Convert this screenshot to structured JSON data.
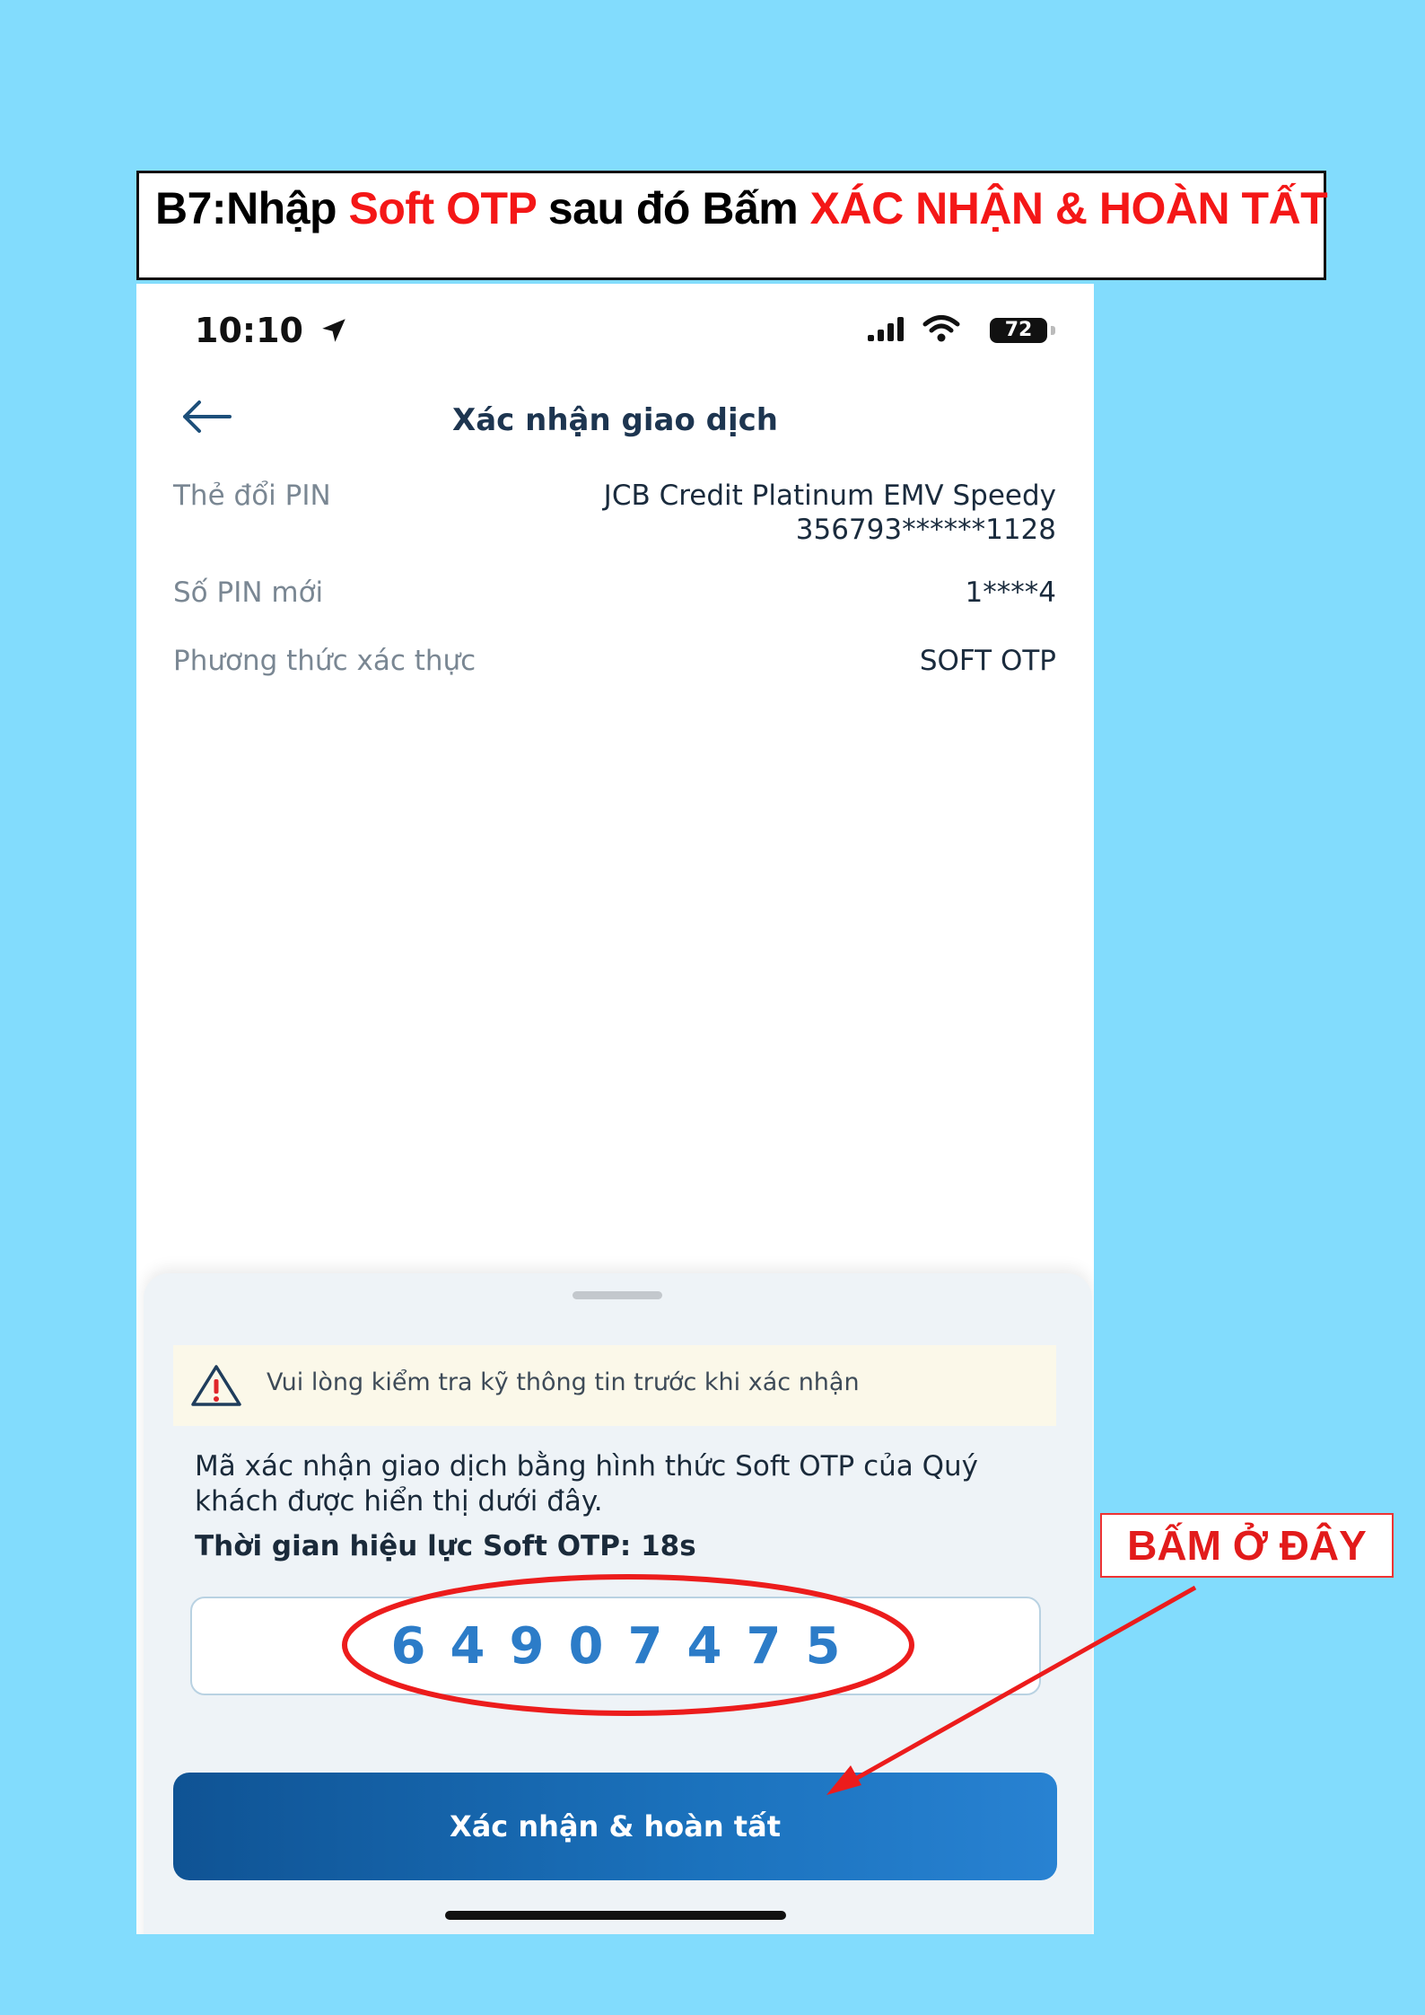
{
  "instruction": {
    "step": "B7:",
    "part1": "Nhập ",
    "highlight1": "Soft OTP",
    "part2": " sau đó Bấm ",
    "highlight2": "XÁC NHẬN & HOÀN TẤT"
  },
  "status_bar": {
    "time": "10:10",
    "battery": "72"
  },
  "header": {
    "title": "Xác nhận giao dịch"
  },
  "details": {
    "card_label": "Thẻ đổi PIN",
    "card_name": "JCB Credit Platinum EMV Speedy",
    "card_number": "356793******1128",
    "pin_label": "Số PIN mới",
    "pin_value": "1****4",
    "auth_label": "Phương thức xác thực",
    "auth_value": "SOFT OTP"
  },
  "sheet": {
    "warning": "Vui lòng kiểm tra kỹ thông tin trước khi xác nhận",
    "description": "Mã xác nhận giao dịch bằng hình thức Soft OTP của Quý khách được hiển thị dưới đây.",
    "validity": "Thời gian hiệu lực Soft OTP:  18s",
    "otp_digits": [
      "6",
      "4",
      "9",
      "0",
      "7",
      "4",
      "7",
      "5"
    ],
    "confirm_label": "Xác nhận & hoàn tất"
  },
  "annotation": {
    "callout": "BẤM Ở ĐÂY",
    "color": "#e21b1b"
  },
  "colors": {
    "background": "#82dcfd",
    "accent_blue": "#2c7cc8",
    "button": "#1566ad"
  }
}
